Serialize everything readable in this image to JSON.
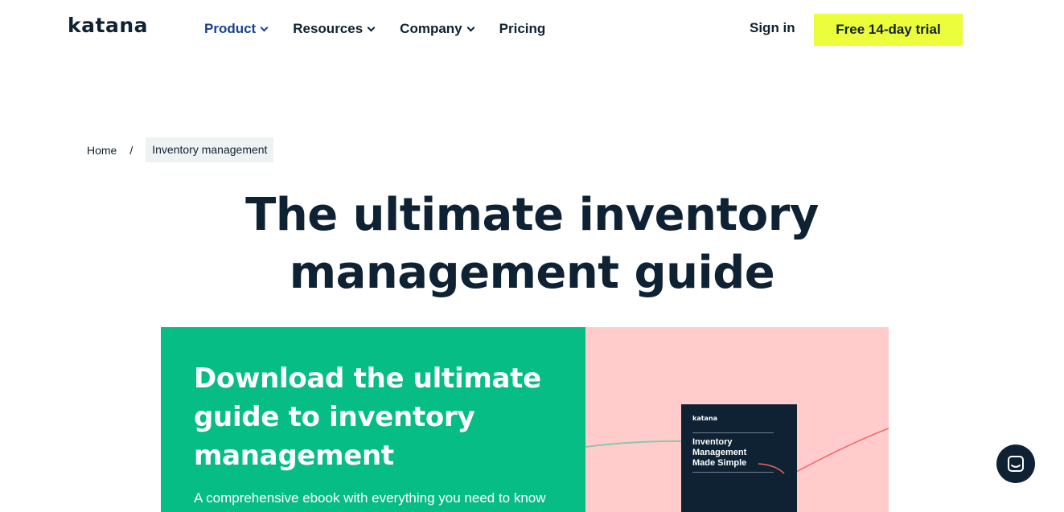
{
  "header": {
    "logo": "katana",
    "nav": [
      {
        "label": "Product",
        "dropdown": true,
        "active": true
      },
      {
        "label": "Resources",
        "dropdown": true
      },
      {
        "label": "Company",
        "dropdown": true
      },
      {
        "label": "Pricing",
        "dropdown": false
      }
    ],
    "sign_in": "Sign in",
    "trial_button": "Free 14-day trial"
  },
  "breadcrumb": {
    "home": "Home",
    "separator": "/",
    "current": "Inventory management"
  },
  "hero": {
    "title_line1": "The ultimate inventory",
    "title_line2": "management guide"
  },
  "banner": {
    "heading_line1": "Download the ultimate",
    "heading_line2": "guide to inventory",
    "heading_line3": "management",
    "text": "A comprehensive ebook with everything you need to know",
    "book": {
      "logo": "katana",
      "title_line1": "Inventory",
      "title_line2": "Management",
      "title_line3": "Made Simple"
    }
  },
  "colors": {
    "brand_dark": "#0f2233",
    "nav_active": "#19418f",
    "cta_yellow": "#ecfd3c",
    "banner_green": "#06bd86",
    "banner_pink": "#ffcccb"
  },
  "icons": {
    "nav_dropdown": "chevron-down-icon",
    "chat": "chat-icon"
  }
}
